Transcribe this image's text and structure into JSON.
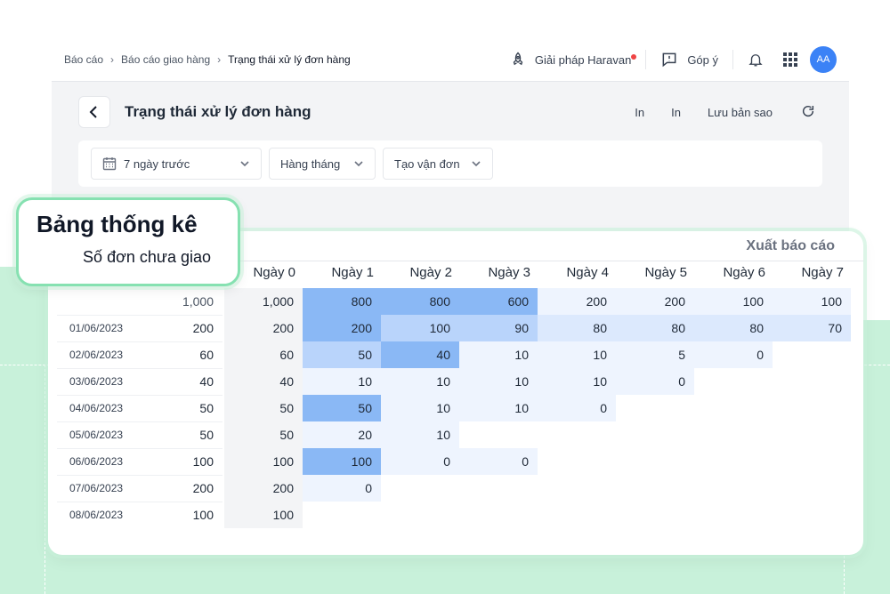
{
  "breadcrumb": [
    "Báo cáo",
    "Báo cáo giao hàng",
    "Trạng thái xử lý đơn hàng"
  ],
  "topbar": {
    "solutions_label": "Giải pháp Haravan",
    "feedback_label": "Góp ý",
    "avatar_initials": "AA"
  },
  "page": {
    "title": "Trạng thái xử lý đơn hàng",
    "actions": [
      "In",
      "In",
      "Lưu bản sao"
    ]
  },
  "filters": {
    "date_range": "7 ngày trước",
    "period": "Hàng tháng",
    "metric": "Tạo vận đơn"
  },
  "callout": {
    "title": "Bảng thống kê",
    "subtitle": "Số đơn chưa giao"
  },
  "table": {
    "export_label": "Xuất báo cáo",
    "columns": [
      "Ngày 0",
      "Ngày 1",
      "Ngày 2",
      "Ngày 3",
      "Ngày 4",
      "Ngày 5",
      "Ngày 6",
      "Ngày 7"
    ],
    "summary": {
      "total": "1,000",
      "values": [
        "1,000",
        "800",
        "800",
        "600",
        "200",
        "200",
        "100",
        "100"
      ]
    },
    "rows": [
      {
        "date": "01/06/2023",
        "total": "200",
        "values": [
          "200",
          "200",
          "100",
          "90",
          "80",
          "80",
          "80",
          "70"
        ]
      },
      {
        "date": "02/06/2023",
        "total": "60",
        "values": [
          "60",
          "50",
          "40",
          "10",
          "10",
          "5",
          "0"
        ]
      },
      {
        "date": "03/06/2023",
        "total": "40",
        "values": [
          "40",
          "10",
          "10",
          "10",
          "10",
          "0"
        ]
      },
      {
        "date": "04/06/2023",
        "total": "50",
        "values": [
          "50",
          "50",
          "10",
          "10",
          "0"
        ]
      },
      {
        "date": "05/06/2023",
        "total": "50",
        "values": [
          "50",
          "20",
          "10"
        ]
      },
      {
        "date": "06/06/2023",
        "total": "100",
        "values": [
          "100",
          "100",
          "0",
          "0"
        ]
      },
      {
        "date": "07/06/2023",
        "total": "200",
        "values": [
          "200",
          "0"
        ]
      },
      {
        "date": "08/06/2023",
        "total": "100",
        "values": [
          "100"
        ]
      }
    ]
  },
  "colors": {
    "avatar": "#3b82f6",
    "accent_green": "#86e1b1",
    "heat_strong": "#8ab8f5",
    "heat_medium": "#b9d4fb",
    "heat_light": "#dce9fd",
    "heat_faint": "#eef4fe",
    "day0_bg": "#f3f4f6"
  }
}
